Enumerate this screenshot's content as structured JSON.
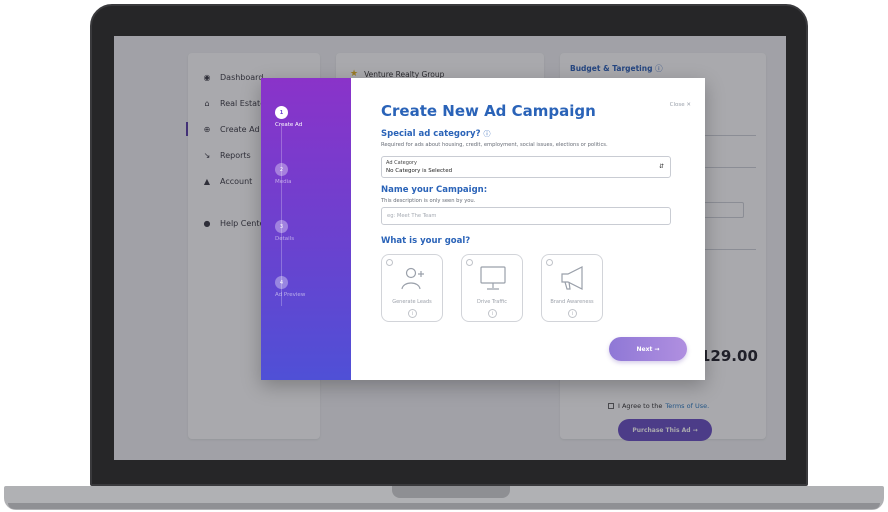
{
  "dashboard": {
    "nav": [
      {
        "icon": "palette-icon",
        "glyph": "◉",
        "label": "Dashboard"
      },
      {
        "icon": "home-icon",
        "glyph": "⌂",
        "label": "Real Estate"
      },
      {
        "icon": "plus-circle-icon",
        "glyph": "⊕",
        "label": "Create Ad"
      },
      {
        "icon": "chart-icon",
        "glyph": "↘",
        "label": "Reports"
      },
      {
        "icon": "user-icon",
        "glyph": "▲",
        "label": "Account"
      },
      {
        "icon": "help-icon",
        "glyph": "●",
        "label": "Help Center"
      }
    ],
    "group_name": "Venture Realty Group",
    "budget_title": "Budget & Targeting",
    "price": "129.00",
    "agree_text": "I Agree to the",
    "terms_link": "Terms of Use.",
    "purchase_button": "Purchase This Ad →"
  },
  "modal": {
    "steps": [
      {
        "number": "1",
        "label": "Create Ad",
        "active": true
      },
      {
        "number": "2",
        "label": "Media",
        "active": false
      },
      {
        "number": "3",
        "label": "Details",
        "active": false
      },
      {
        "number": "4",
        "label": "Ad Preview",
        "active": false
      }
    ],
    "close_label": "Close ✕",
    "title": "Create New Ad Campaign",
    "category_heading": "Special ad category?",
    "category_subtext": "Required for ads about housing, credit, employment, social issues, elections or politics.",
    "select_label": "Ad Category",
    "select_value": "No Category is Selected",
    "name_heading": "Name your Campaign:",
    "name_subtext": "This description is only seen by you.",
    "name_placeholder": "eg: Meet The Team",
    "goal_heading": "What is your goal?",
    "goals": [
      {
        "label": "Generate Leads",
        "icon": "leads-icon"
      },
      {
        "label": "Drive Traffic",
        "icon": "monitor-icon"
      },
      {
        "label": "Brand Awareness",
        "icon": "megaphone-icon"
      }
    ],
    "next_button": "Next →"
  },
  "colors": {
    "accent_blue": "#2a63b8",
    "sidebar_gradient_top": "#8a33c9",
    "sidebar_gradient_bottom": "#4f50d6"
  }
}
